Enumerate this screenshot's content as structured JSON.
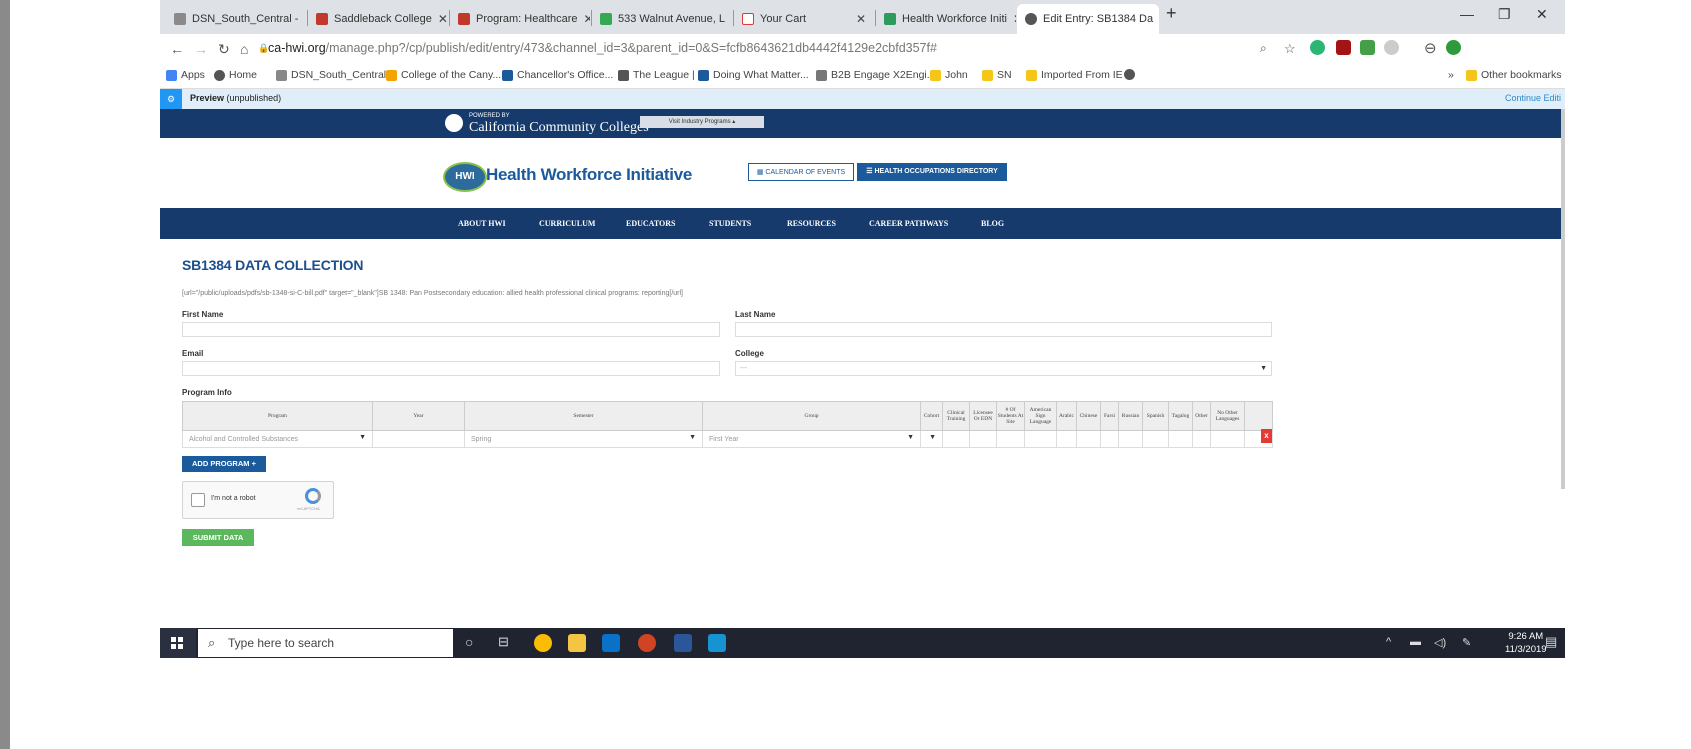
{
  "tabs": [
    {
      "label": "DSN_South_Central - ",
      "active": false
    },
    {
      "label": "Saddleback College",
      "active": false
    },
    {
      "label": "Program: Healthcare",
      "active": false
    },
    {
      "label": "533 Walnut Avenue, L",
      "active": false
    },
    {
      "label": "Your Cart",
      "active": false
    },
    {
      "label": "Health Workforce Initi",
      "active": false
    },
    {
      "label": "Edit Entry: SB1384 Da",
      "active": true
    }
  ],
  "window": {
    "new_tab": "+",
    "minimize": "—",
    "maximize": "❐",
    "close": "✕"
  },
  "address": {
    "domain": "ca-hwi.org",
    "path": "/manage.php?/cp/publish/edit/entry/473&channel_id=3&parent_id=0&S=fcfb8643621db4442f4129e2cbfd357f#"
  },
  "bookmarks": [
    "Apps",
    "Home",
    "DSN_South_Central...",
    "College of the Cany...",
    "Chancellor's Office...",
    "The League |",
    "Doing What Matter...",
    "B2B Engage X2Engi...",
    "John",
    "SN",
    "Imported From IE",
    "»",
    "Other bookmarks"
  ],
  "preview": {
    "label": "Preview",
    "status": "(unpublished)",
    "right": "Continue Editi"
  },
  "ccc": {
    "powered": "POWERED BY",
    "name": "California Community Colleges",
    "visit": "Visit Industry Programs ▴"
  },
  "hwi": {
    "logo": "HWI",
    "title": "Health Workforce Initiative",
    "calendar": "▦ CALENDAR OF EVENTS",
    "directory": "☰ HEALTH OCCUPATIONS DIRECTORY"
  },
  "menu": [
    "ABOUT HWI",
    "CURRICULUM",
    "EDUCATORS",
    "STUDENTS",
    "RESOURCES",
    "CAREER PATHWAYS",
    "BLOG"
  ],
  "form": {
    "title": "SB1384 DATA COLLECTION",
    "url_line": "[url=\"/public/uploads/pdfs/sb-1348-si-C-bill.pdf\" target=\"_blank\"]SB 1348: Pan Postsecondary education: allied health professional clinical programs: reporting[/url]",
    "first_name_label": "First Name",
    "last_name_label": "Last Name",
    "email_label": "Email",
    "college_label": "College",
    "college_value": "---",
    "program_info_label": "Program Info",
    "columns": [
      "Program",
      "Year",
      "Semester",
      "Group",
      "Cohort",
      "Clinical Training",
      "Licensee Or EDN",
      "# Of Students At Site",
      "American Sign Language",
      "Arabic",
      "Chinese",
      "Farsi",
      "Russian",
      "Spanish",
      "Tagalog",
      "Other",
      "No Other Languages"
    ],
    "row": {
      "program": "Alcohol and Controlled Substances",
      "year": "",
      "semester": "Spring",
      "group": "First Year"
    },
    "delete": "x",
    "add_program": "ADD PROGRAM +",
    "captcha_text": "I'm not a robot",
    "captcha_brand": "reCAPTCHA",
    "submit": "SUBMIT DATA"
  },
  "taskbar": {
    "search_placeholder": "Type here to search",
    "time": "9:26 AM",
    "date": "11/3/2019"
  }
}
